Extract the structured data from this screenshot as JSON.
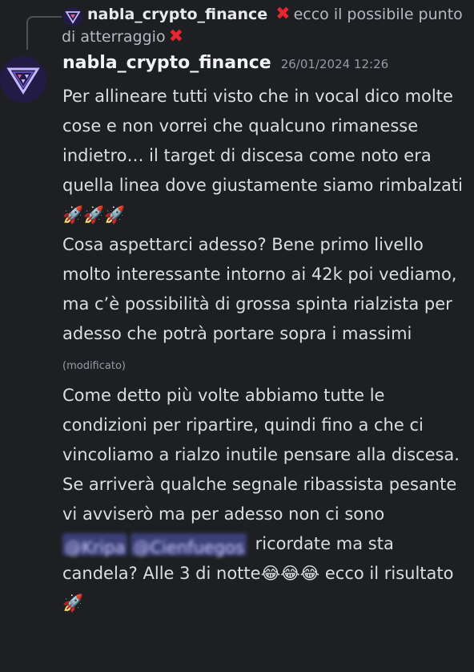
{
  "reply": {
    "author": "nabla_crypto_finance",
    "text_before": "ecco il possibile punto di atterraggio",
    "x_icon": "cross-mark-icon"
  },
  "message": {
    "author": "nabla_crypto_finance",
    "timestamp": "26/01/2024 12:26",
    "p1": "Per allineare tutti visto che in vocal dico molte cose e non vorrei che qualcuno rimanesse indietro… il target di discesa come noto era quella linea dove giustamente siamo rimbalzati",
    "p1_emoji": "🚀🚀🚀",
    "p2": "Cosa aspettarci adesso? Bene primo livello molto interessante  intorno ai 42k poi vediamo, ma c’è possibilità di grossa spinta rialzista per adesso che potrà portare sopra i massimi",
    "p2_edited": "(modificato)",
    "p3": "Come detto più volte abbiamo tutte le condizioni per ripartire, quindi fino a che ci vincoliamo a rialzo inutile pensare alla discesa. Se arriverà qualche segnale ribassista pesante vi avviserò ma per adesso non ci sono",
    "mention1": "@Kripa",
    "mention2": "@Cienfuegos",
    "p4a": "ricordate ma sta candela? Alle 3 di notte",
    "p4_emoji": "😂😂😂",
    "p4b": "ecco il risultato",
    "p4_end_emoji": "🚀"
  },
  "colors": {
    "background": "#1e1f22",
    "author": "#f2f3f5",
    "text": "#dbdee1",
    "timestamp": "#949ba4",
    "cross": "#e8262f"
  }
}
